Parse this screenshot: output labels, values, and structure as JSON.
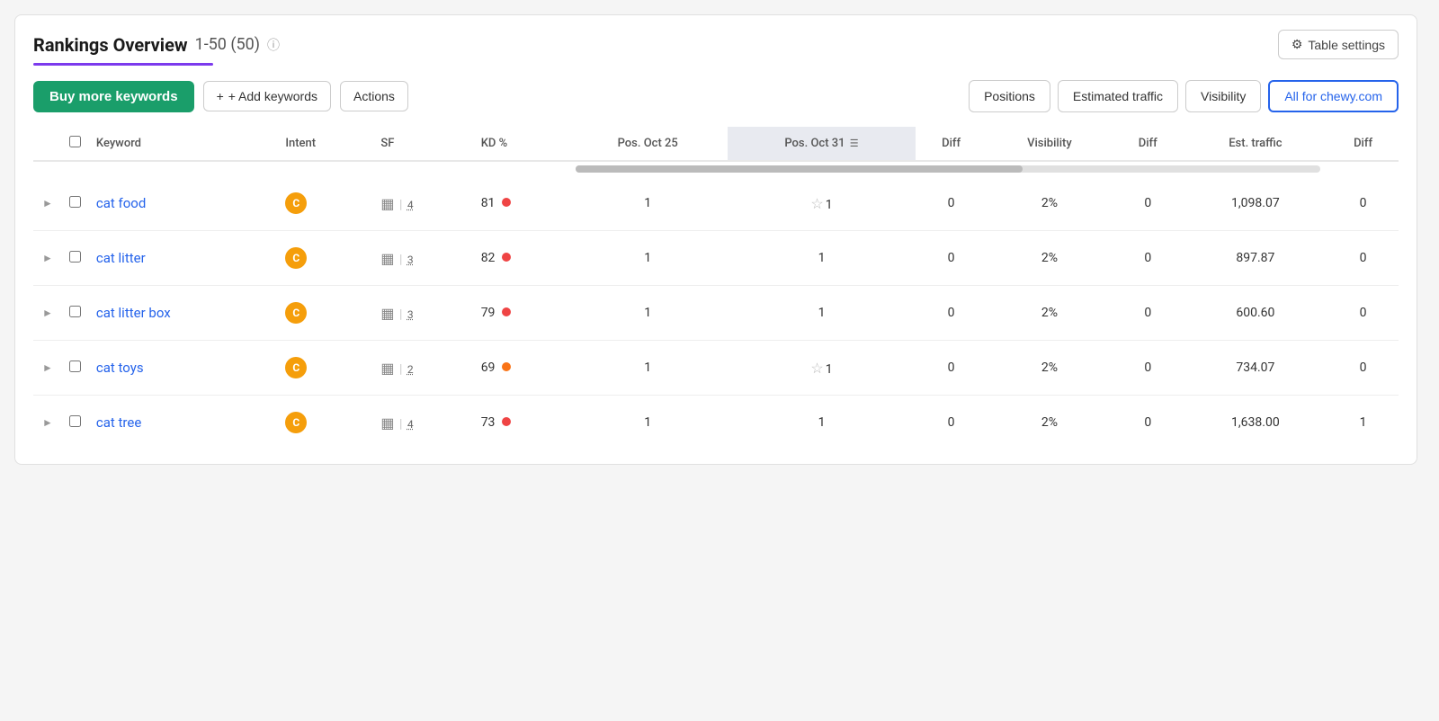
{
  "header": {
    "title": "Rankings Overview",
    "range": "1-50 (50)",
    "info_icon": "ℹ",
    "table_settings_label": "Table settings",
    "gear_icon": "⚙"
  },
  "toolbar": {
    "buy_keywords_label": "Buy more keywords",
    "add_keywords_label": "+ Add keywords",
    "actions_label": "Actions",
    "tabs": [
      {
        "label": "Positions",
        "active": false
      },
      {
        "label": "Estimated traffic",
        "active": false
      },
      {
        "label": "Visibility",
        "active": false
      },
      {
        "label": "All for chewy.com",
        "active": true
      }
    ]
  },
  "table": {
    "columns": [
      {
        "key": "expand",
        "label": ""
      },
      {
        "key": "checkbox",
        "label": ""
      },
      {
        "key": "keyword",
        "label": "Keyword"
      },
      {
        "key": "intent",
        "label": "Intent"
      },
      {
        "key": "sf",
        "label": "SF"
      },
      {
        "key": "kd",
        "label": "KD %"
      },
      {
        "key": "pos_oct25",
        "label": "Pos. Oct 25"
      },
      {
        "key": "pos_oct31",
        "label": "Pos. Oct 31",
        "sorted": true
      },
      {
        "key": "diff",
        "label": "Diff"
      },
      {
        "key": "visibility",
        "label": "Visibility"
      },
      {
        "key": "vis_diff",
        "label": "Diff"
      },
      {
        "key": "est_traffic",
        "label": "Est. traffic"
      },
      {
        "key": "est_diff",
        "label": "Diff"
      }
    ],
    "rows": [
      {
        "keyword": "cat food",
        "intent": "C",
        "sf_num": "4",
        "kd": "81",
        "kd_color": "red",
        "pos_oct25": "1",
        "pos_oct31": "1",
        "pos_oct31_star": true,
        "diff": "0",
        "visibility": "2%",
        "vis_diff": "0",
        "est_traffic": "1,098.07",
        "est_diff": "0"
      },
      {
        "keyword": "cat litter",
        "intent": "C",
        "sf_num": "3",
        "kd": "82",
        "kd_color": "red",
        "pos_oct25": "1",
        "pos_oct31": "1",
        "pos_oct31_star": false,
        "diff": "0",
        "visibility": "2%",
        "vis_diff": "0",
        "est_traffic": "897.87",
        "est_diff": "0"
      },
      {
        "keyword": "cat litter box",
        "intent": "C",
        "sf_num": "3",
        "kd": "79",
        "kd_color": "red",
        "pos_oct25": "1",
        "pos_oct31": "1",
        "pos_oct31_star": false,
        "diff": "0",
        "visibility": "2%",
        "vis_diff": "0",
        "est_traffic": "600.60",
        "est_diff": "0"
      },
      {
        "keyword": "cat toys",
        "intent": "C",
        "sf_num": "2",
        "kd": "69",
        "kd_color": "orange",
        "pos_oct25": "1",
        "pos_oct31": "1",
        "pos_oct31_star": true,
        "diff": "0",
        "visibility": "2%",
        "vis_diff": "0",
        "est_traffic": "734.07",
        "est_diff": "0"
      },
      {
        "keyword": "cat tree",
        "intent": "C",
        "sf_num": "4",
        "kd": "73",
        "kd_color": "red",
        "pos_oct25": "1",
        "pos_oct31": "1",
        "pos_oct31_star": false,
        "diff": "0",
        "visibility": "2%",
        "vis_diff": "0",
        "est_traffic": "1,638.00",
        "est_diff": "1"
      }
    ]
  }
}
